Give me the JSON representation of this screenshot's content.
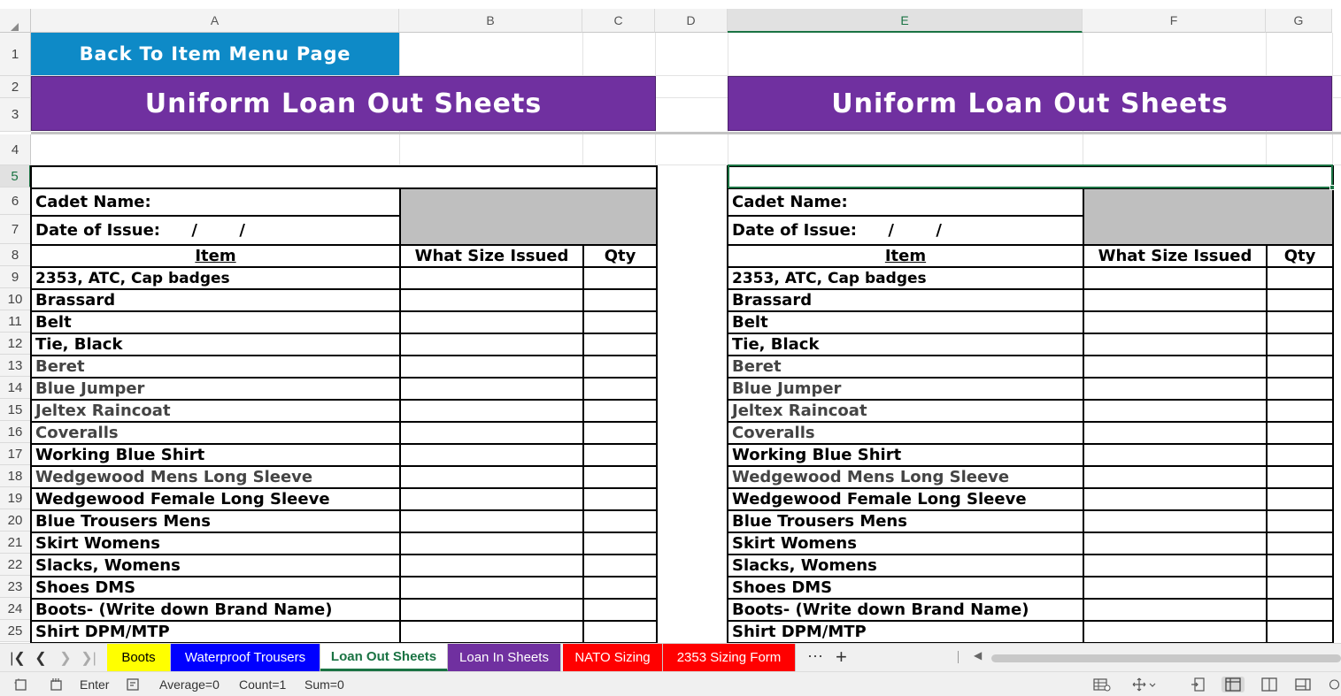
{
  "columns": [
    "A",
    "B",
    "C",
    "D",
    "E",
    "F",
    "G"
  ],
  "selected_column": "E",
  "rows": [
    "1",
    "2",
    "3",
    "4",
    "5",
    "6",
    "7",
    "8",
    "9",
    "10",
    "11",
    "12",
    "13",
    "14",
    "15",
    "16",
    "17",
    "18",
    "19",
    "20",
    "21",
    "22",
    "23",
    "24",
    "25"
  ],
  "selected_row": "5",
  "back_button": "Back To Item Menu Page",
  "banner_title": "Uniform Loan Out Sheets",
  "form": {
    "cadet_name_label": "Cadet Name:",
    "date_label": "Date of Issue:",
    "date_sep1": "/",
    "date_sep2": "/",
    "item_header": "Item",
    "size_header": "What Size Issued",
    "qty_header": "Qty"
  },
  "items": [
    "2353, ATC, Cap badges",
    "Brassard",
    "Belt",
    "Tie, Black",
    "Beret",
    "Blue Jumper",
    "Jeltex Raincoat",
    "Coveralls",
    "Working Blue Shirt",
    "Wedgewood Mens Long Sleeve",
    "Wedgewood Female Long Sleeve",
    "Blue Trousers Mens",
    "Skirt Womens",
    "Slacks, Womens",
    "Shoes DMS",
    "Boots- (Write down Brand Name)",
    "Shirt DPM/MTP"
  ],
  "sheet_tabs": [
    {
      "label": "Boots",
      "bg": "#ffff00",
      "fg": "#000000"
    },
    {
      "label": "Waterproof Trousers",
      "bg": "#0000ff",
      "fg": "#ffffff"
    },
    {
      "label": "Loan Out Sheets",
      "bg": "#ffffff",
      "fg": "#1a7343"
    },
    {
      "label": "Loan In Sheets",
      "bg": "#7030a0",
      "fg": "#ffffff"
    },
    {
      "label": "NATO Sizing",
      "bg": "#ff0000",
      "fg": "#ffffff"
    },
    {
      "label": "2353 Sizing Form",
      "bg": "#ff0000",
      "fg": "#ffffff"
    }
  ],
  "active_tab": "Loan Out Sheets",
  "tab_more": "⋯",
  "tab_add": "+",
  "status": {
    "mode": "Enter",
    "average": "Average=0",
    "count": "Count=1",
    "sum": "Sum=0"
  },
  "colors": {
    "banner": "#7030a0",
    "back_button": "#0e8ac7",
    "header_fill": "#bfbfbf",
    "selection": "#1a7343"
  },
  "icons": [
    "first-sheet-icon",
    "prev-sheet-icon",
    "next-sheet-icon",
    "last-sheet-icon",
    "cell-mode-icon",
    "macro-icon",
    "accessibility-icon",
    "table-view-icon",
    "move-icon",
    "page-break-icon",
    "normal-view-icon",
    "page-layout-icon",
    "reading-view-icon",
    "zoom-icon"
  ]
}
